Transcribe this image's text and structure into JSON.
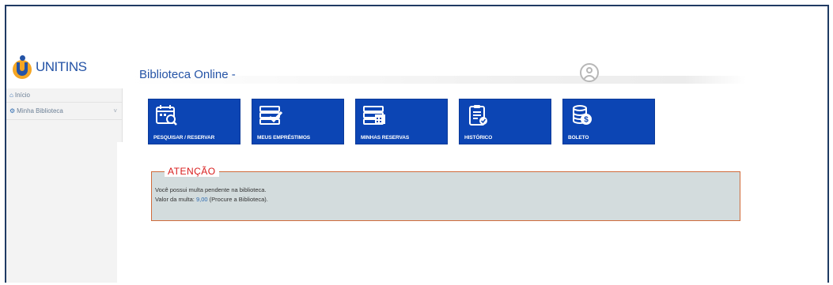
{
  "header": {
    "logo_text": "UNITINS",
    "app_title": "Biblioteca Online -"
  },
  "sidebar": {
    "items": [
      {
        "label": "Início",
        "icon": "home-icon"
      },
      {
        "label": "Minha Biblioteca",
        "icon": "cog-icon",
        "chevron": "˅"
      }
    ]
  },
  "tiles": [
    {
      "label": "PESQUISAR / RESERVAR",
      "icon": "calendar-search-icon"
    },
    {
      "label": "MEUS EMPRÉSTIMOS",
      "icon": "books-check-icon"
    },
    {
      "label": "MINHAS RESERVAS",
      "icon": "books-calendar-icon"
    },
    {
      "label": "HISTÓRICO",
      "icon": "clipboard-icon"
    },
    {
      "label": "BOLETO",
      "icon": "coins-icon"
    }
  ],
  "alert": {
    "title": "ATENÇÃO",
    "line1": "Você possui multa pendente na biblioteca.",
    "line2_prefix": "Valor da multa: ",
    "amount": "9,00",
    "line2_suffix": " (Procure a Biblioteca)."
  },
  "colors": {
    "brand_blue": "#0c45b4",
    "logo_orange": "#f5a623",
    "alert_red": "#d81b1b",
    "alert_bg": "#d3dcdd",
    "alert_border": "#d06b3b"
  }
}
